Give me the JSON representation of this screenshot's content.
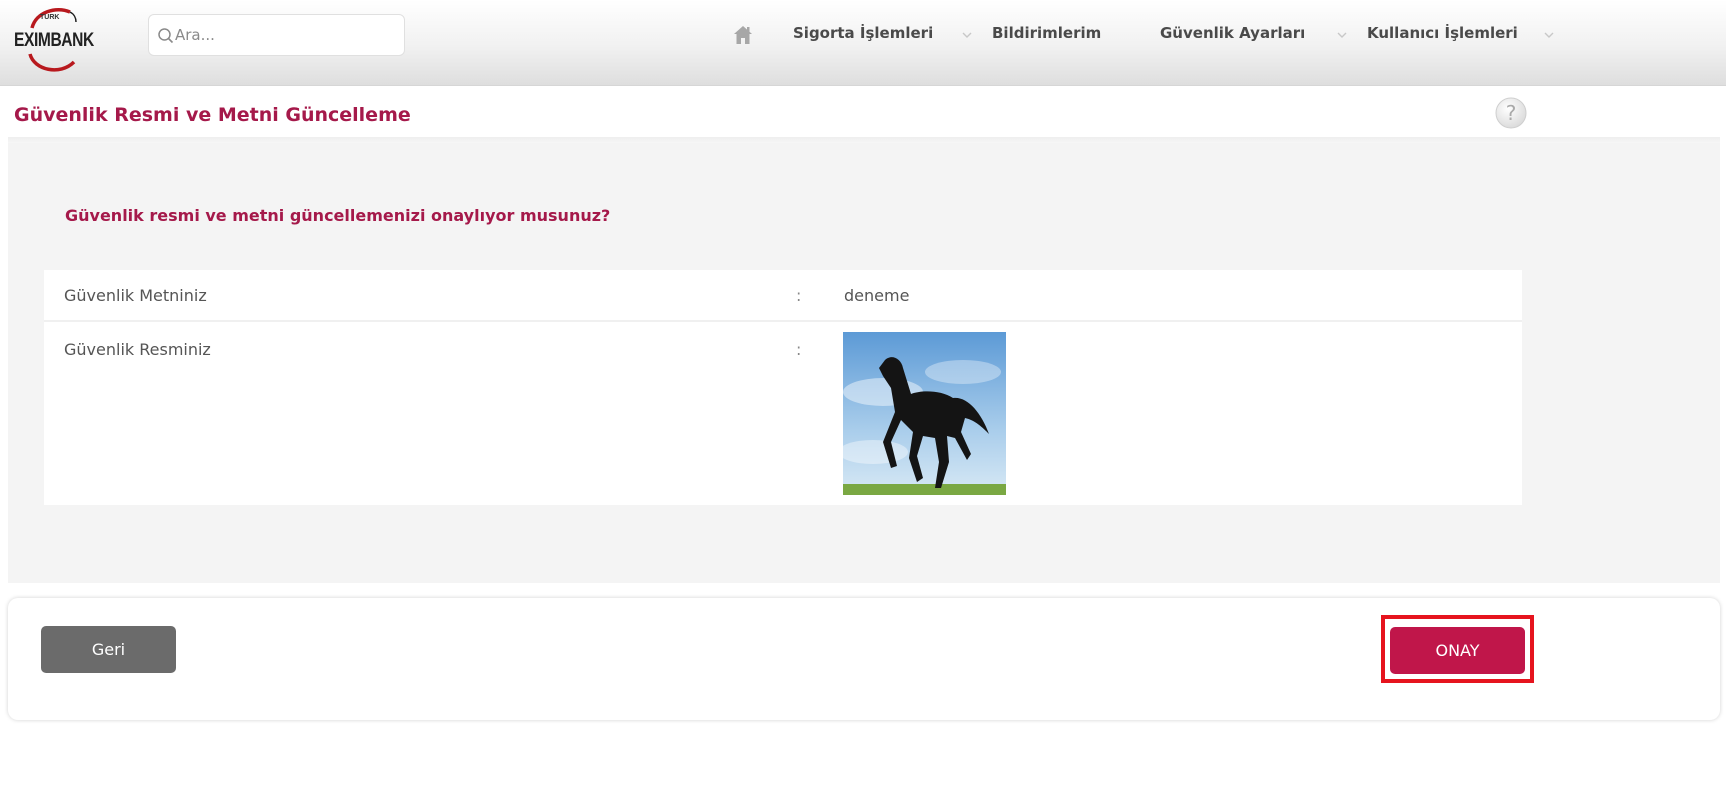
{
  "brand": {
    "logo_top": "TURK",
    "logo_main": "EXIMBANK"
  },
  "search": {
    "placeholder": "Ara..."
  },
  "nav": {
    "home_icon": "home-icon",
    "items": [
      {
        "label": "Sigorta İşlemleri",
        "has_dropdown": true
      },
      {
        "label": "Bildirimlerim",
        "has_dropdown": false
      },
      {
        "label": "Güvenlik Ayarları",
        "has_dropdown": true
      },
      {
        "label": "Kullanıcı İşlemleri",
        "has_dropdown": true
      }
    ]
  },
  "page": {
    "title": "Güvenlik Resmi ve Metni Güncelleme",
    "help_icon": "help-icon",
    "question": "Güvenlik resmi ve metni güncellemenizi onaylıyor musunuz?"
  },
  "details": [
    {
      "label": "Güvenlik Metniniz",
      "separator": ":",
      "value": "deneme"
    },
    {
      "label": "Güvenlik Resminiz",
      "separator": ":",
      "value_icon": "horse-image"
    }
  ],
  "actions": {
    "back_label": "Geri",
    "confirm_label": "ONAY"
  },
  "colors": {
    "accent": "#a5194a",
    "confirm_button": "#c0164a",
    "back_button": "#6b6b6b",
    "highlight": "#e6141e"
  }
}
